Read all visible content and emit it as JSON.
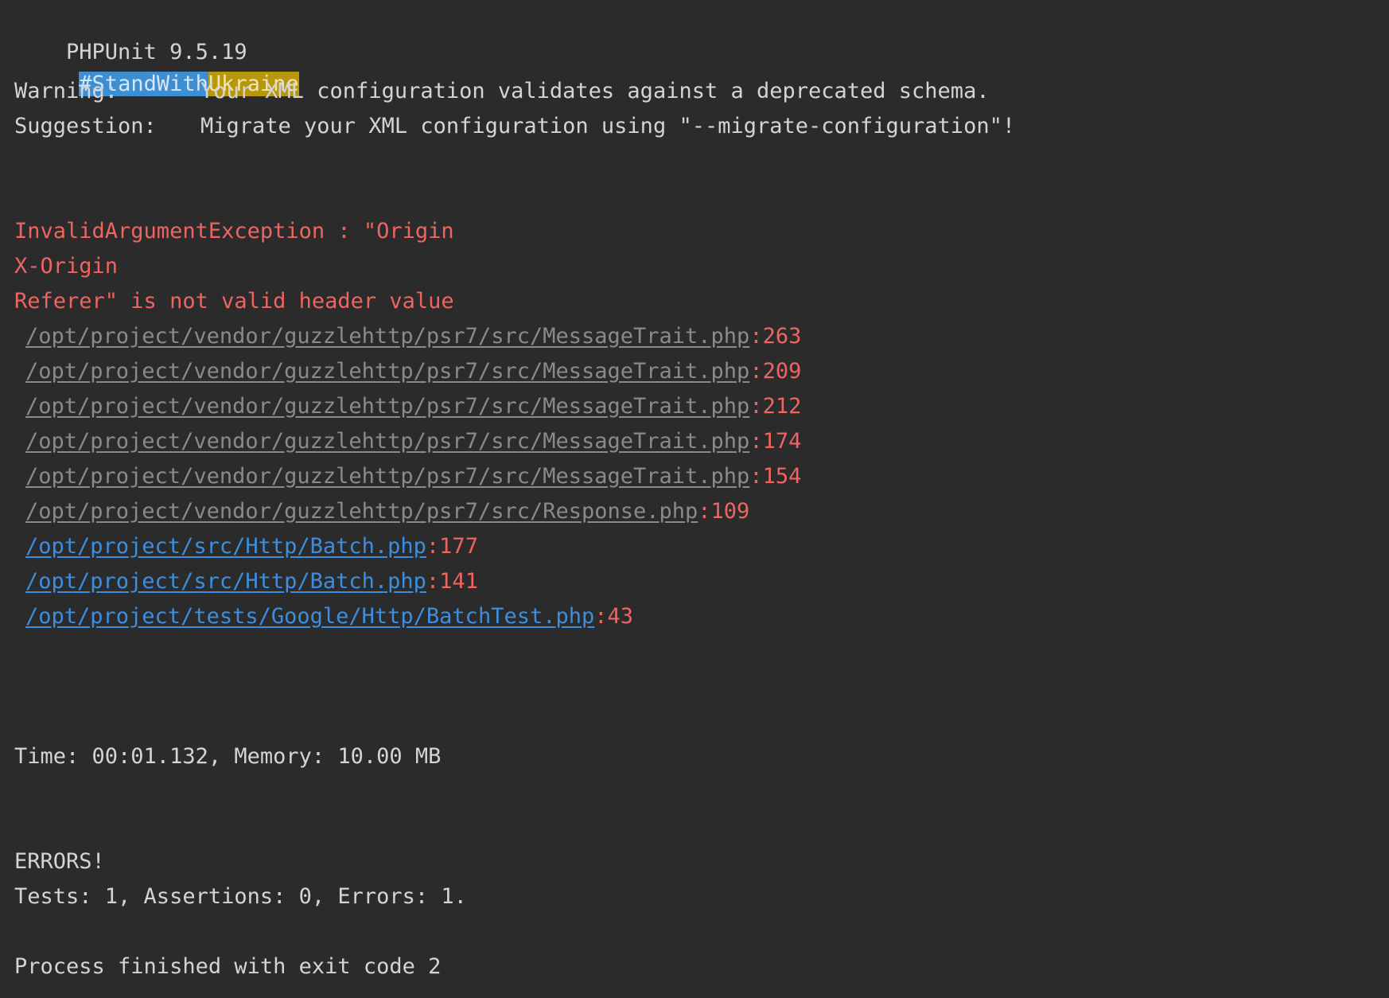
{
  "header": {
    "version": "PHPUnit 9.5.19",
    "tag_part1": "#StandWith",
    "tag_part2": "Ukraine"
  },
  "notices": [
    {
      "label": "Warning:",
      "text": "Your XML configuration validates against a deprecated schema."
    },
    {
      "label": "Suggestion:",
      "text": "Migrate your XML configuration using \"--migrate-configuration\"!"
    }
  ],
  "exception": {
    "lines": [
      "InvalidArgumentException : \"Origin",
      "X-Origin",
      "Referer\" is not valid header value"
    ]
  },
  "stack_trace": [
    {
      "path": "/opt/project/vendor/guzzlehttp/psr7/src/MessageTrait.php",
      "line": ":263",
      "kind": "vendor"
    },
    {
      "path": "/opt/project/vendor/guzzlehttp/psr7/src/MessageTrait.php",
      "line": ":209",
      "kind": "vendor"
    },
    {
      "path": "/opt/project/vendor/guzzlehttp/psr7/src/MessageTrait.php",
      "line": ":212",
      "kind": "vendor"
    },
    {
      "path": "/opt/project/vendor/guzzlehttp/psr7/src/MessageTrait.php",
      "line": ":174",
      "kind": "vendor"
    },
    {
      "path": "/opt/project/vendor/guzzlehttp/psr7/src/MessageTrait.php",
      "line": ":154",
      "kind": "vendor"
    },
    {
      "path": "/opt/project/vendor/guzzlehttp/psr7/src/Response.php",
      "line": ":109",
      "kind": "vendor"
    },
    {
      "path": "/opt/project/src/Http/Batch.php",
      "line": ":177",
      "kind": "project"
    },
    {
      "path": "/opt/project/src/Http/Batch.php",
      "line": ":141",
      "kind": "project"
    },
    {
      "path": "/opt/project/tests/Google/Http/BatchTest.php",
      "line": ":43",
      "kind": "project"
    }
  ],
  "summary": {
    "time_memory": "Time: 00:01.132, Memory: 10.00 MB",
    "errors_heading": "ERRORS!",
    "counts": "Tests: 1, Assertions: 0, Errors: 1.",
    "exit": "Process finished with exit code 2"
  },
  "colors": {
    "background": "#2b2b2b",
    "text": "#d4d4d4",
    "error": "#ef6461",
    "link_project": "#3c8ee0",
    "link_vendor": "#8a8a8a",
    "tag_blue": "#3d8fd1",
    "tag_yellow": "#b8970d"
  }
}
